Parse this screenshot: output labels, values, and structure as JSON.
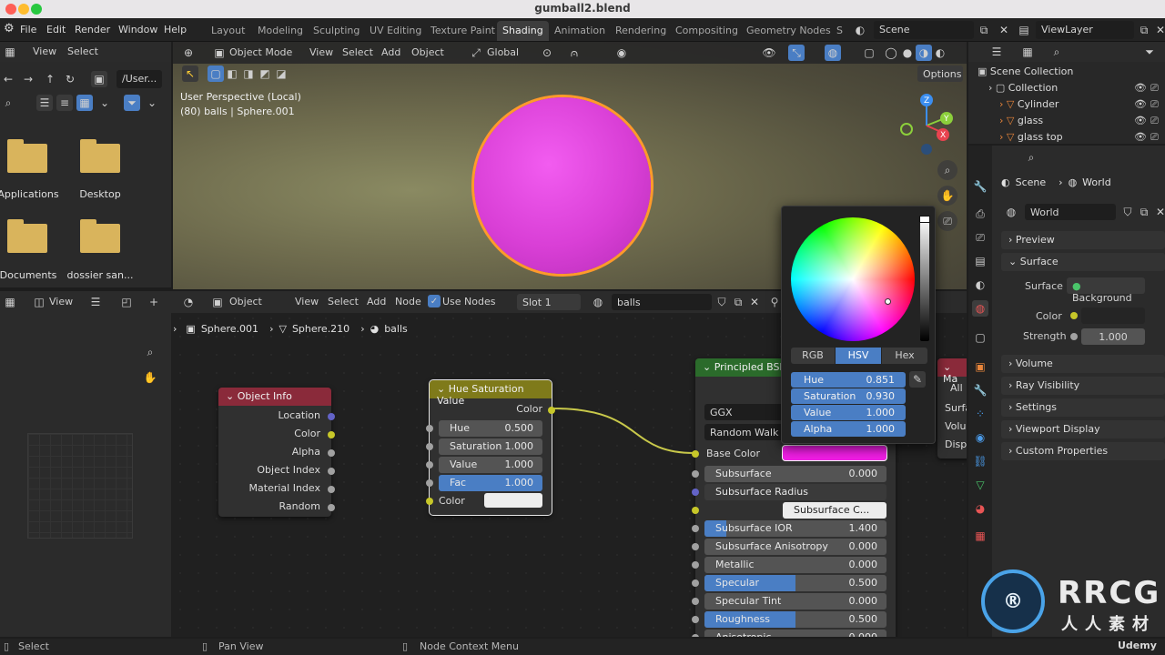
{
  "window": {
    "title": "gumball2.blend"
  },
  "menu": {
    "items": [
      "File",
      "Edit",
      "Render",
      "Window",
      "Help"
    ],
    "workspaces": [
      "Layout",
      "Modeling",
      "Sculpting",
      "UV Editing",
      "Texture Paint",
      "Shading",
      "Animation",
      "Rendering",
      "Compositing",
      "Geometry Nodes",
      "S"
    ],
    "active_workspace": "Shading",
    "scene": "Scene",
    "view_layer": "ViewLayer"
  },
  "file_browser": {
    "menu": [
      "View",
      "Select"
    ],
    "path": "/User...",
    "items": [
      "Applications",
      "Desktop",
      "Documents",
      "dossier san..."
    ]
  },
  "viewport": {
    "mode": "Object Mode",
    "menu": [
      "View",
      "Select",
      "Add",
      "Object"
    ],
    "transform": "Global",
    "options_label": "Options",
    "info_line1": "User Perspective (Local)",
    "info_line2": "(80) balls | Sphere.001",
    "gizmo_axes": [
      "X",
      "Y",
      "Z"
    ]
  },
  "node_editor": {
    "type": "Object",
    "menu": [
      "View",
      "Select",
      "Add",
      "Node"
    ],
    "use_nodes_label": "Use Nodes",
    "slot": "Slot 1",
    "material": "balls",
    "breadcrumb": [
      "Sphere.001",
      "Sphere.210",
      "balls"
    ],
    "left_panel": {
      "view_label": "View"
    },
    "object_info": {
      "title": "Object Info",
      "outputs": [
        "Location",
        "Color",
        "Alpha",
        "Object Index",
        "Material Index",
        "Random"
      ]
    },
    "hsv_node": {
      "title": "Hue Saturation Value",
      "output": "Color",
      "inputs": [
        {
          "label": "Hue",
          "value": "0.500",
          "fill": 0
        },
        {
          "label": "Saturation",
          "value": "1.000",
          "fill": 0
        },
        {
          "label": "Value",
          "value": "1.000",
          "fill": 0
        },
        {
          "label": "Fac",
          "value": "1.000",
          "fill": 1.0
        }
      ],
      "color_label": "Color"
    },
    "principled": {
      "title": "Principled BSDF",
      "distribution": "GGX",
      "subsurface_method": "Random Walk",
      "base_color_label": "Base Color",
      "rows": [
        {
          "label": "Subsurface",
          "value": "0.000",
          "fill": 0
        },
        {
          "label": "Subsurface Radius",
          "value": "",
          "fill": 0
        },
        {
          "label": "Subsurface C...",
          "value": "",
          "fill": 0
        },
        {
          "label": "Subsurface IOR",
          "value": "1.400",
          "fill": 0.12
        },
        {
          "label": "Subsurface Anisotropy",
          "value": "0.000",
          "fill": 0
        },
        {
          "label": "Metallic",
          "value": "0.000",
          "fill": 0
        },
        {
          "label": "Specular",
          "value": "0.500",
          "fill": 0.5
        },
        {
          "label": "Specular Tint",
          "value": "0.000",
          "fill": 0
        },
        {
          "label": "Roughness",
          "value": "0.500",
          "fill": 0.5
        },
        {
          "label": "Anisotropic",
          "value": "0.000",
          "fill": 0
        }
      ]
    },
    "material_output": {
      "title": "Ma",
      "target": "All",
      "sockets": [
        "Surfa",
        "Volu",
        "Displ"
      ]
    }
  },
  "color_picker": {
    "tabs": [
      "RGB",
      "HSV",
      "Hex"
    ],
    "active_tab": "HSV",
    "fields": [
      {
        "label": "Hue",
        "value": "0.851"
      },
      {
        "label": "Saturation",
        "value": "0.930"
      },
      {
        "label": "Value",
        "value": "1.000"
      },
      {
        "label": "Alpha",
        "value": "1.000"
      }
    ]
  },
  "outliner": {
    "items": [
      {
        "label": "Scene Collection",
        "indent": 0
      },
      {
        "label": "Collection",
        "indent": 1
      },
      {
        "label": "Cylinder",
        "indent": 2
      },
      {
        "label": "glass",
        "indent": 2
      },
      {
        "label": "glass top",
        "indent": 2
      }
    ]
  },
  "properties": {
    "breadcrumb": [
      "Scene",
      "World"
    ],
    "world_name": "World",
    "sections": [
      "Preview",
      "Surface",
      "Volume",
      "Ray Visibility",
      "Settings",
      "Viewport Display",
      "Custom Properties"
    ],
    "surface_label": "Surface",
    "surface_value": "Background",
    "color_label": "Color",
    "strength_label": "Strength",
    "strength_value": "1.000"
  },
  "statusbar": {
    "items": [
      "Select",
      "Pan View",
      "Node Context Menu"
    ]
  },
  "watermark": {
    "text": "RRCG",
    "subtext": "人人素材",
    "udemy": "Udemy"
  },
  "colors": {
    "accent_blue": "#4a7ec4",
    "object_info_header": "#8a2a3a",
    "hsv_header": "#7f7a1a",
    "principled_header": "#2b6b2b",
    "base_color": "#f21ee6",
    "sphere": "#e040dc"
  }
}
